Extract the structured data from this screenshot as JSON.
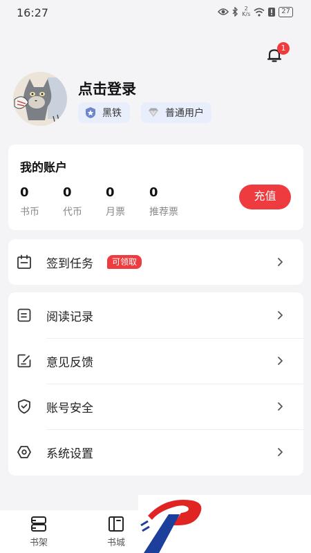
{
  "status_bar": {
    "time": "16:27",
    "net_speed_value": "2",
    "net_speed_unit": "K/s",
    "battery": "27"
  },
  "notifications": {
    "badge_count": "1"
  },
  "profile": {
    "login_prompt": "点击登录",
    "level_tag": "黑铁",
    "user_type_tag": "普通用户"
  },
  "account": {
    "title": "我的账户",
    "stats": [
      {
        "value": "0",
        "label": "书币"
      },
      {
        "value": "0",
        "label": "代币"
      },
      {
        "value": "0",
        "label": "月票"
      },
      {
        "value": "0",
        "label": "推荐票"
      }
    ],
    "recharge_label": "充值"
  },
  "task": {
    "label": "签到任务",
    "badge": "可领取",
    "icon": "calendar-icon"
  },
  "menu": [
    {
      "label": "阅读记录",
      "icon": "reading-history-icon"
    },
    {
      "label": "意见反馈",
      "icon": "feedback-edit-icon"
    },
    {
      "label": "账号安全",
      "icon": "shield-check-icon"
    },
    {
      "label": "系统设置",
      "icon": "settings-hexagon-icon"
    }
  ],
  "bottom_nav": [
    {
      "label": "书架",
      "icon": "bookshelf-icon"
    },
    {
      "label": "书城",
      "icon": "bookstore-icon"
    }
  ],
  "colors": {
    "accent_red": "#ee3b3f",
    "tag_bg": "#e8eefb",
    "page_bg": "#f4f4f6"
  }
}
